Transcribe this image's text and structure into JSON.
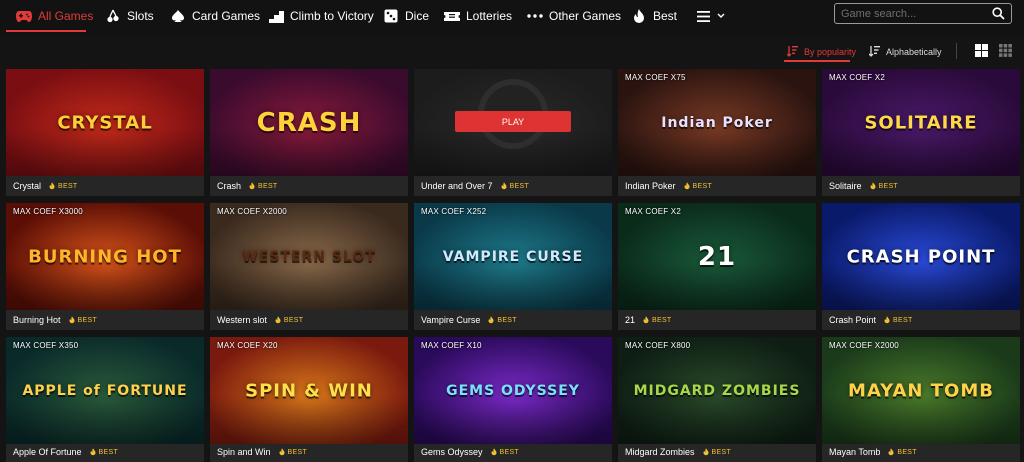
{
  "nav": {
    "items": [
      {
        "label": "All Games",
        "icon": "gamepad-icon"
      },
      {
        "label": "Slots",
        "icon": "cherries-icon"
      },
      {
        "label": "Card Games",
        "icon": "spade-icon"
      },
      {
        "label": "Climb to Victory",
        "icon": "stairs-icon"
      },
      {
        "label": "Dice",
        "icon": "dice-icon"
      },
      {
        "label": "Lotteries",
        "icon": "ticket-icon"
      },
      {
        "label": "Other Games",
        "icon": "dots-icon"
      },
      {
        "label": "Best",
        "icon": "flame-icon"
      }
    ],
    "accent": "#e03a3a"
  },
  "search": {
    "placeholder": "Game search..."
  },
  "sort": {
    "popularity": "By popularity",
    "alphabetical": "Alphabetically"
  },
  "best_label": "BEST",
  "play_label": "PLAY",
  "games": [
    {
      "name": "Crystal",
      "coef": "",
      "logo": "CRYSTAL",
      "bg": [
        "#7a0e12",
        "#c32a1a"
      ],
      "logo_color": "#ffcf3a"
    },
    {
      "name": "Crash",
      "coef": "",
      "logo": "CRASH",
      "bg": [
        "#3b0b2e",
        "#8a1a3a"
      ],
      "logo_color": "#ffd23a"
    },
    {
      "name": "Under and Over 7",
      "coef": "",
      "logo": "",
      "bg": [
        "#1c1c1c",
        "#2a2a2a"
      ],
      "logo_color": "#fff",
      "hover": true
    },
    {
      "name": "Indian Poker",
      "coef": "MAX COEF X75",
      "logo": "Indian Poker",
      "bg": [
        "#2b1410",
        "#7a3a24"
      ],
      "logo_color": "#e9e2ff"
    },
    {
      "name": "Solitaire",
      "coef": "MAX COEF X2",
      "logo": "SOLITAIRE",
      "bg": [
        "#2a0a3a",
        "#4a1a6a"
      ],
      "logo_color": "#ffd84a"
    },
    {
      "name": "Burning Hot",
      "coef": "MAX COEF X3000",
      "logo": "BURNING HOT",
      "bg": [
        "#5a0e06",
        "#d8541a"
      ],
      "logo_color": "#ffb42a"
    },
    {
      "name": "Western slot",
      "coef": "MAX COEF X2000",
      "logo": "WESTERN SLOT",
      "bg": [
        "#3a2a1e",
        "#8a6a4a"
      ],
      "logo_color": "#5a2a12"
    },
    {
      "name": "Vampire Curse",
      "coef": "MAX COEF X252",
      "logo": "VAMPIRE CURSE",
      "bg": [
        "#0a3a4a",
        "#1e7a8a"
      ],
      "logo_color": "#cfe9ff"
    },
    {
      "name": "21",
      "coef": "MAX COEF X2",
      "logo": "21",
      "bg": [
        "#0a2a1a",
        "#1a5a3a"
      ],
      "logo_color": "#ffffff"
    },
    {
      "name": "Crash Point",
      "coef": "",
      "logo": "CRASH POINT",
      "bg": [
        "#0a1a6a",
        "#2a4ad8"
      ],
      "logo_color": "#ffffff"
    },
    {
      "name": "Apple Of Fortune",
      "coef": "MAX COEF X350",
      "logo": "APPLE of FORTUNE",
      "bg": [
        "#0a2a2a",
        "#2a5a3a"
      ],
      "logo_color": "#ffd24a"
    },
    {
      "name": "Spin and Win",
      "coef": "MAX COEF X20",
      "logo": "SPIN & WIN",
      "bg": [
        "#7a1a0e",
        "#d8781a"
      ],
      "logo_color": "#ffe04a"
    },
    {
      "name": "Gems Odyssey",
      "coef": "MAX COEF X10",
      "logo": "GEMS ODYSSEY",
      "bg": [
        "#2a0a5a",
        "#7a2ac8"
      ],
      "logo_color": "#7ae0ff"
    },
    {
      "name": "Midgard Zombies",
      "coef": "MAX COEF X800",
      "logo": "MIDGARD ZOMBIES",
      "bg": [
        "#0e1e14",
        "#2a4a2a"
      ],
      "logo_color": "#a8d84a"
    },
    {
      "name": "Mayan Tomb",
      "coef": "MAX COEF X2000",
      "logo": "MAYAN TOMB",
      "bg": [
        "#1a3a1a",
        "#4a7a2a"
      ],
      "logo_color": "#ffd24a"
    }
  ]
}
